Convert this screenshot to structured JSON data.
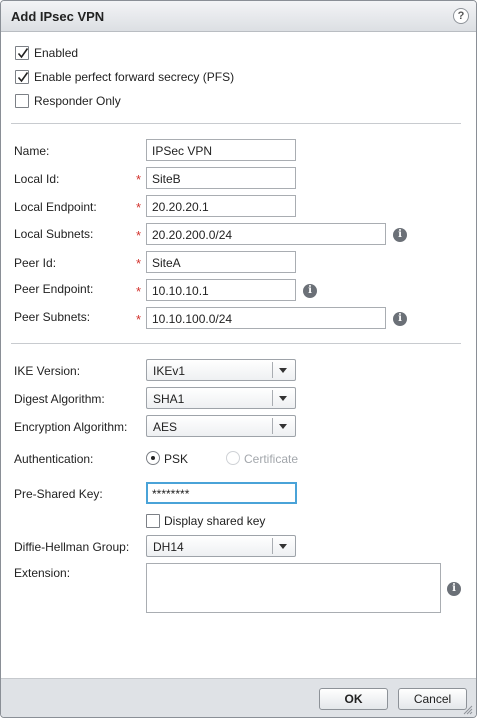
{
  "dialog": {
    "title": "Add IPsec VPN",
    "help_label": "?"
  },
  "options": {
    "enabled": {
      "label": "Enabled",
      "checked": true
    },
    "pfs": {
      "label": "Enable perfect forward secrecy (PFS)",
      "checked": true
    },
    "responder_only": {
      "label": "Responder Only",
      "checked": false
    }
  },
  "fields": {
    "name": {
      "label": "Name:",
      "value": "IPSec VPN",
      "required": false
    },
    "local_id": {
      "label": "Local Id:",
      "value": "SiteB",
      "required": true
    },
    "local_endpoint": {
      "label": "Local Endpoint:",
      "value": "20.20.20.1",
      "required": true
    },
    "local_subnets": {
      "label": "Local Subnets:",
      "value": "20.20.200.0/24",
      "required": true
    },
    "peer_id": {
      "label": "Peer Id:",
      "value": "SiteA",
      "required": true
    },
    "peer_endpoint": {
      "label": "Peer Endpoint:",
      "value": "10.10.10.1",
      "required": true
    },
    "peer_subnets": {
      "label": "Peer Subnets:",
      "value": "10.10.100.0/24",
      "required": true
    }
  },
  "required_marker": "*",
  "info_glyph": "i",
  "ike": {
    "ike_version": {
      "label": "IKE Version:",
      "value": "IKEv1"
    },
    "digest_algorithm": {
      "label": "Digest Algorithm:",
      "value": "SHA1"
    },
    "encryption_algorithm": {
      "label": "Encryption Algorithm:",
      "value": "AES"
    },
    "authentication": {
      "label": "Authentication:",
      "options": [
        {
          "label": "PSK",
          "selected": true,
          "enabled": true
        },
        {
          "label": "Certificate",
          "selected": false,
          "enabled": false
        }
      ]
    },
    "pre_shared_key": {
      "label": "Pre-Shared Key:",
      "value": "********"
    },
    "display_shared_key": {
      "label": "Display shared key",
      "checked": false
    },
    "dh_group": {
      "label": "Diffie-Hellman Group:",
      "value": "DH14"
    },
    "extension": {
      "label": "Extension:",
      "value": ""
    }
  },
  "footer": {
    "ok_label": "OK",
    "cancel_label": "Cancel"
  },
  "colors": {
    "required": "#d2322d",
    "focus_border": "#4aa3d8",
    "footer_bg": "#dfe2e6"
  }
}
